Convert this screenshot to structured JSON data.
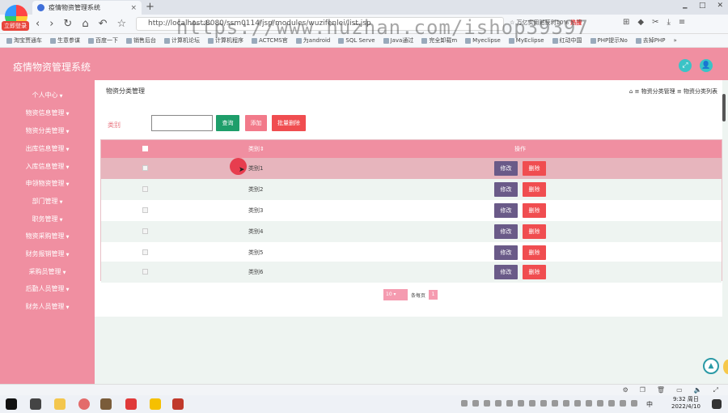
{
  "browser": {
    "tab_title": "疫情物资管理系统",
    "tab_close": "×",
    "new_tab": "+",
    "url": "http://localhost:8080/ssm0114/jsp/modules/wuzifenlei/list.jsp",
    "url_extra": "☆ 万亿实用贴获利10%",
    "url_hot": "热搜",
    "login_badge": "立即登录",
    "nav": [
      "‹",
      "›",
      "↻",
      "⌂",
      "↶",
      "☆"
    ],
    "toolbar_icons": [
      "⊞",
      "◆",
      "✂",
      "⤓",
      "≡"
    ],
    "window_controls": [
      "🗕",
      "□",
      "✕"
    ],
    "bookmarks": [
      "淘宝贾通车",
      "生意参谋",
      "百度一下",
      "销售后台",
      "计算机论坛",
      "计算机程序",
      "ACTCMS官",
      "为android",
      "SQL Serve",
      "Java通过",
      "完全卸载m",
      "Myeclipse",
      "MyEclipse",
      "红动中国",
      "PHP提示No",
      "去掉PHP"
    ],
    "bookmark_more": "»",
    "watermark": "https://www.huzhan.com/ishop39397"
  },
  "app": {
    "title": "疫情物资管理系统",
    "header_icons": [
      "expand-icon",
      "user-icon"
    ],
    "header_glyphs": [
      "⤢",
      "👤"
    ]
  },
  "sidebar": {
    "items": [
      {
        "label": "个人中心"
      },
      {
        "label": "物资信息管理"
      },
      {
        "label": "物资分类管理"
      },
      {
        "label": "出库信息管理"
      },
      {
        "label": "入库信息管理"
      },
      {
        "label": "申领物资管理"
      },
      {
        "label": "部门管理"
      },
      {
        "label": "职务管理"
      },
      {
        "label": "物资采购管理"
      },
      {
        "label": "财务报销管理"
      },
      {
        "label": "采购员管理"
      },
      {
        "label": "后勤人员管理"
      },
      {
        "label": "财务人员管理"
      }
    ],
    "caret": "▼"
  },
  "page": {
    "title": "物资分类管理",
    "breadcrumb": "⌂ ≡ 物资分类管理 ≡ 物资分类列表"
  },
  "search": {
    "label": "类别",
    "value": "",
    "query_btn": "查询",
    "add_btn": "添加",
    "batch_delete_btn": "批量删除"
  },
  "table": {
    "col_name": "类别",
    "col_sort": "⇕",
    "col_action": "操作",
    "edit_label": "修改",
    "delete_label": "删除",
    "rows": [
      {
        "name": "类别1"
      },
      {
        "name": "类别2"
      },
      {
        "name": "类别3"
      },
      {
        "name": "类别4"
      },
      {
        "name": "类别5"
      },
      {
        "name": "类别6"
      }
    ]
  },
  "pager": {
    "page_size": "10",
    "per_page_label": "条每页",
    "current_page": "1"
  },
  "taskbar": {
    "ime": "中",
    "time": "9:32 周日",
    "date": "2022/4/10"
  },
  "colors": {
    "primary_pink": "#f08fa1",
    "query_green": "#1e9e6a",
    "add_pink": "#f27a8a",
    "delete_red": "#f04d50",
    "edit_purple": "#6a5a88",
    "teal": "#3bc3c6"
  }
}
